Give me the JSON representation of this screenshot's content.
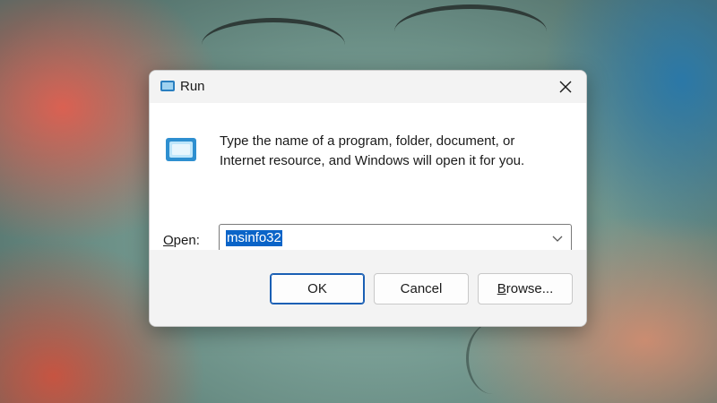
{
  "window": {
    "title": "Run",
    "title_icon": "run-icon",
    "close_icon": "close-icon"
  },
  "content": {
    "app_icon": "run-app-icon",
    "description_line1": "Type the name of a program, folder, document, or",
    "description_line2": "Internet resource, and Windows will open it for you.",
    "open_label_accel": "O",
    "open_label_rest": "pen:",
    "open_value": "msinfo32",
    "dropdown_icon": "chevron-down-icon"
  },
  "buttons": {
    "ok": "OK",
    "cancel": "Cancel",
    "browse_accel": "B",
    "browse_rest": "rowse..."
  },
  "colors": {
    "accent": "#0a64c8",
    "dialog_bg": "#ffffff",
    "footer_bg": "#f3f3f3"
  }
}
